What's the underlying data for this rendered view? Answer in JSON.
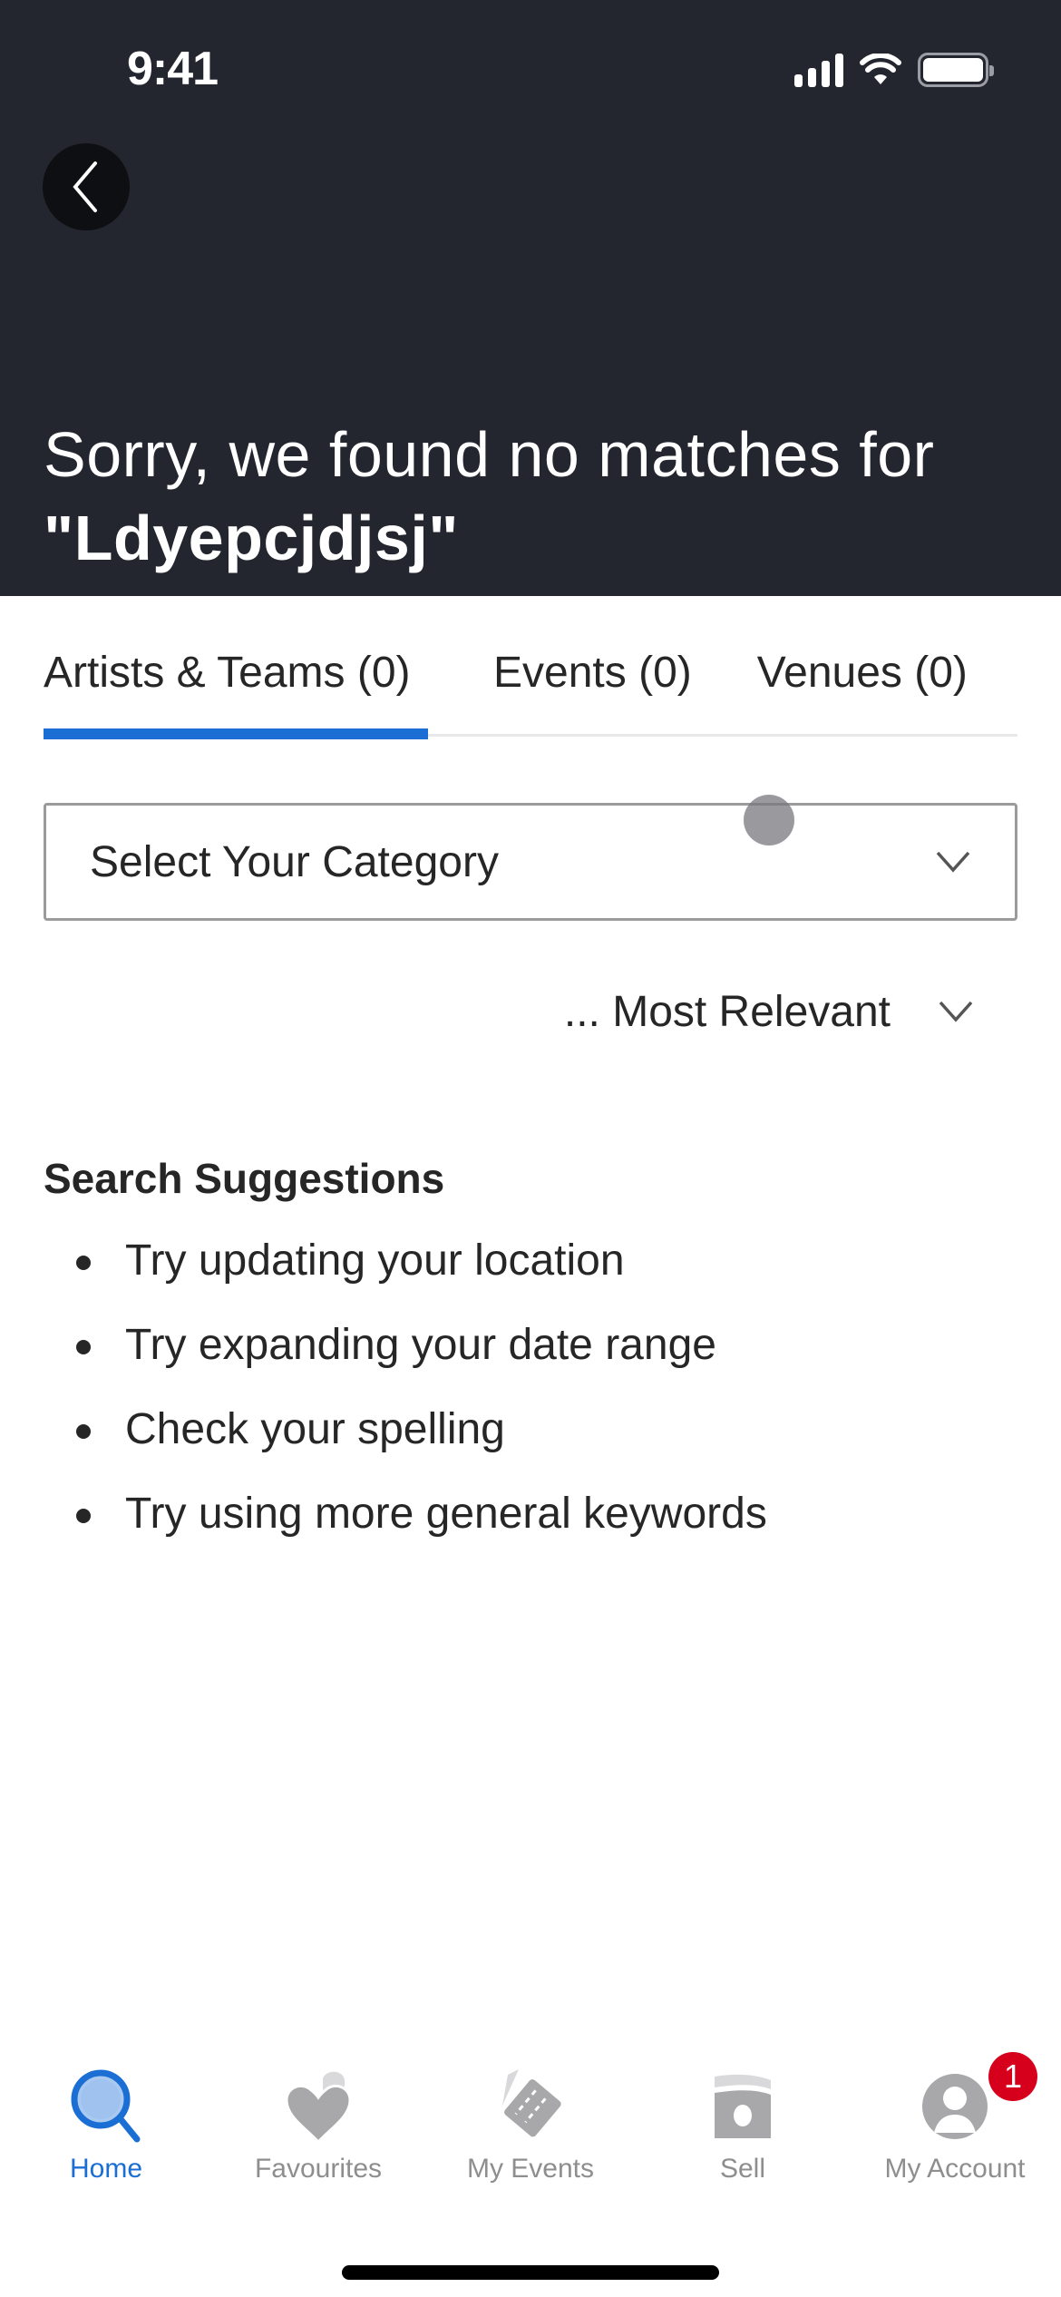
{
  "status_bar": {
    "time": "9:41"
  },
  "header": {
    "back_label": "Back",
    "title_prefix": "Sorry, we found no matches for",
    "query": "\"Ldyepcjdjsj\""
  },
  "tabs": [
    {
      "label": "Artists & Teams (0)",
      "active": true
    },
    {
      "label": "Events (0)",
      "active": false
    },
    {
      "label": "Venues (0)",
      "active": false
    }
  ],
  "filters": {
    "category_placeholder": "Select Your Category",
    "sort_label": "... Most Relevant"
  },
  "suggestions": {
    "title": "Search Suggestions",
    "items": [
      "Try updating your location",
      "Try expanding your date range",
      "Check your spelling",
      "Try using more general keywords"
    ]
  },
  "tabbar": {
    "items": [
      {
        "label": "Home",
        "icon": "search-icon",
        "active": true
      },
      {
        "label": "Favourites",
        "icon": "heart-icon",
        "active": false
      },
      {
        "label": "My Events",
        "icon": "ticket-icon",
        "active": false
      },
      {
        "label": "Sell",
        "icon": "money-icon",
        "active": false
      },
      {
        "label": "My Account",
        "icon": "account-icon",
        "active": false,
        "badge": "1"
      }
    ]
  },
  "colors": {
    "header_bg": "#23262f",
    "accent": "#1b6ed3",
    "badge": "#d6001c",
    "inactive_icon": "#a8a8a8"
  }
}
